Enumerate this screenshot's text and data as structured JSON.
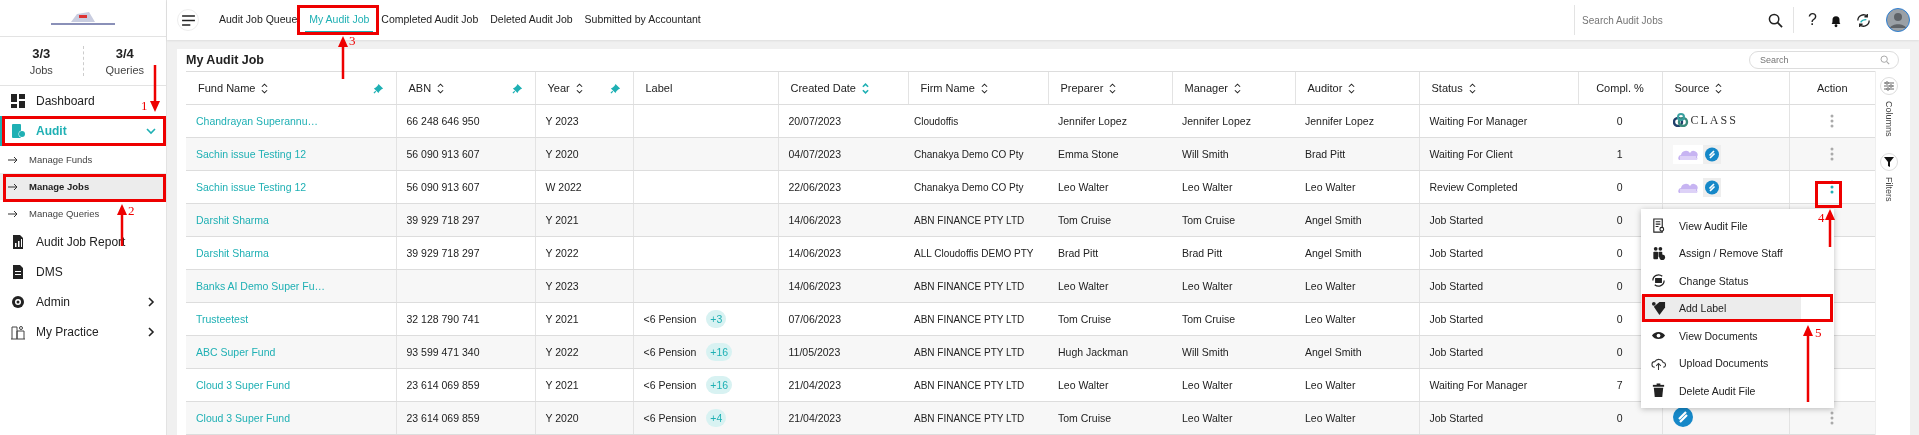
{
  "sidebar": {
    "stats": [
      {
        "value": "3/3",
        "label": "Jobs"
      },
      {
        "value": "3/4",
        "label": "Queries"
      }
    ],
    "menu": [
      {
        "label": "Dashboard",
        "selected": false
      },
      {
        "label": "Audit",
        "selected": true,
        "expanded": true,
        "children": [
          {
            "label": "Manage Funds",
            "selected": false
          },
          {
            "label": "Manage Jobs",
            "selected": true
          },
          {
            "label": "Manage Queries",
            "selected": false
          }
        ]
      },
      {
        "label": "Audit Job Report",
        "selected": false
      },
      {
        "label": "DMS",
        "selected": false
      },
      {
        "label": "Admin",
        "selected": false,
        "expanded": false
      },
      {
        "label": "My Practice",
        "selected": false,
        "expanded": false
      }
    ]
  },
  "topbar": {
    "tabs": [
      {
        "label": "Audit Job Queue",
        "selected": false
      },
      {
        "label": "My Audit Job",
        "selected": true
      },
      {
        "label": "Completed Audit Job",
        "selected": false
      },
      {
        "label": "Deleted Audit Job",
        "selected": false
      },
      {
        "label": "Submitted by Accountant",
        "selected": false
      }
    ],
    "search": {
      "placeholder": "Search Audit Jobs"
    },
    "help": "?"
  },
  "card": {
    "title": "My Audit Job",
    "search": {
      "placeholder": "Search"
    }
  },
  "table": {
    "columns": [
      {
        "label": "Fund Name",
        "sortable": true,
        "sorted": false,
        "pinned": true
      },
      {
        "label": "ABN",
        "sortable": true,
        "sorted": false,
        "pinned": true
      },
      {
        "label": "Year",
        "sortable": true,
        "sorted": false,
        "pinned": true
      },
      {
        "label": "Label",
        "sortable": false,
        "pinned": false
      },
      {
        "label": "Created Date",
        "sortable": true,
        "sorted": true,
        "pinned": false
      },
      {
        "label": "Firm Name",
        "sortable": true,
        "sorted": false,
        "pinned": false
      },
      {
        "label": "Preparer",
        "sortable": true,
        "sorted": false,
        "pinned": false
      },
      {
        "label": "Manager",
        "sortable": true,
        "sorted": false,
        "pinned": false
      },
      {
        "label": "Auditor",
        "sortable": true,
        "sorted": false,
        "pinned": false
      },
      {
        "label": "Status",
        "sortable": true,
        "sorted": false,
        "pinned": false
      },
      {
        "label": "Compl. %",
        "sortable": false,
        "pinned": false
      },
      {
        "label": "Source",
        "sortable": true,
        "sorted": false,
        "pinned": false
      },
      {
        "label": "Action",
        "sortable": false,
        "pinned": false
      }
    ],
    "rows": [
      {
        "fund_name": "Chandrayan Superannu…",
        "abn": "66 248 646 950",
        "year": "Y 2023",
        "created": "20/07/2023",
        "firm": "Cloudoffis",
        "preparer": "Jennifer Lopez",
        "manager": "Jennifer Lopez",
        "auditor": "Jennifer Lopez",
        "status": "Waiting For Manager",
        "compl": "0",
        "source": {
          "kind": "class",
          "text": "CLASS"
        },
        "menu_active": false
      },
      {
        "fund_name": "Sachin issue Testing 12",
        "abn": "56 090 913 607",
        "year": "Y 2020",
        "created": "04/07/2023",
        "firm": "Chanakya Demo CO Pty",
        "preparer": "Emma Stone",
        "manager": "Will Smith",
        "auditor": "Brad Pitt",
        "status": "Waiting For Client",
        "compl": "1",
        "source": {
          "kind": "cloud-sync"
        },
        "menu_active": false
      },
      {
        "fund_name": "Sachin issue Testing 12",
        "abn": "56 090 913 607",
        "year": "W 2022",
        "created": "22/06/2023",
        "firm": "Chanakya Demo CO Pty",
        "preparer": "Leo Walter",
        "manager": "Leo Walter",
        "auditor": "Leo Walter",
        "status": "Review Completed",
        "compl": "0",
        "source": {
          "kind": "cloud-sync"
        },
        "menu_active": true
      },
      {
        "fund_name": "Darshit Sharma",
        "abn": "39 929 718 297",
        "year": "Y 2021",
        "created": "14/06/2023",
        "firm": "ABN FINANCE PTY LTD",
        "preparer": "Tom Cruise",
        "manager": "Tom Cruise",
        "auditor": "Angel Smith",
        "status": "Job Started",
        "compl": "0"
      },
      {
        "fund_name": "Darshit Sharma",
        "abn": "39 929 718 297",
        "year": "Y 2022",
        "created": "14/06/2023",
        "firm": "ALL Cloudoffis DEMO PTY",
        "preparer": "Brad Pitt",
        "manager": "Brad Pitt",
        "auditor": "Angel Smith",
        "status": "Job Started",
        "compl": "0"
      },
      {
        "fund_name": "Banks AI Demo Super Fu…",
        "year": "Y 2023",
        "created": "14/06/2023",
        "firm": "ABN FINANCE PTY LTD",
        "preparer": "Leo Walter",
        "manager": "Leo Walter",
        "auditor": "Leo Walter",
        "status": "Job Started",
        "compl": "0"
      },
      {
        "fund_name": "Trusteetest",
        "abn": "32 128 790 741",
        "year": "Y 2021",
        "label": "<6 Pension",
        "label_extra": "+3",
        "created": "07/06/2023",
        "firm": "ABN FINANCE PTY LTD",
        "preparer": "Tom Cruise",
        "manager": "Tom Cruise",
        "auditor": "Leo Walter",
        "status": "Job Started",
        "compl": "0"
      },
      {
        "fund_name": "ABC Super Fund",
        "abn": "93 599 471 340",
        "year": "Y 2022",
        "label": "<6 Pension",
        "label_extra": "+16",
        "created": "11/05/2023",
        "firm": "ABN FINANCE PTY LTD",
        "preparer": "Hugh Jackman",
        "manager": "Will Smith",
        "auditor": "Angel Smith",
        "status": "Job Started",
        "compl": "0"
      },
      {
        "fund_name": "Cloud 3 Super Fund",
        "abn": "23 614 069 859",
        "year": "Y 2021",
        "label": "<6 Pension",
        "label_extra": "+16",
        "created": "21/04/2023",
        "firm": "ABN FINANCE PTY LTD",
        "preparer": "Leo Walter",
        "manager": "Leo Walter",
        "auditor": "Leo Walter",
        "status": "Waiting For Manager",
        "compl": "7"
      },
      {
        "fund_name": "Cloud 3 Super Fund",
        "abn": "23 614 069 859",
        "year": "Y 2020",
        "label": "<6 Pension",
        "label_extra": "+4",
        "created": "21/04/2023",
        "firm": "ABN FINANCE PTY LTD",
        "preparer": "Tom Cruise",
        "manager": "Leo Walter",
        "auditor": "Leo Walter",
        "status": "Job Started",
        "compl": "0",
        "source": {
          "kind": "sync"
        },
        "menu_active": false
      }
    ]
  },
  "side_strip": [
    "Columns",
    "Filters"
  ],
  "action_menu": [
    {
      "label": "View Audit File",
      "selected": false
    },
    {
      "label": "Assign / Remove Staff",
      "selected": false
    },
    {
      "label": "Change Status",
      "selected": false
    },
    {
      "label": "Add Label",
      "selected": true
    },
    {
      "label": "View Documents",
      "selected": false
    },
    {
      "label": "Upload Documents",
      "selected": false
    },
    {
      "label": "Delete Audit File",
      "selected": false
    }
  ],
  "annotations": [
    {
      "number": "1"
    },
    {
      "number": "2"
    },
    {
      "number": "3"
    },
    {
      "number": "4"
    },
    {
      "number": "5"
    }
  ]
}
